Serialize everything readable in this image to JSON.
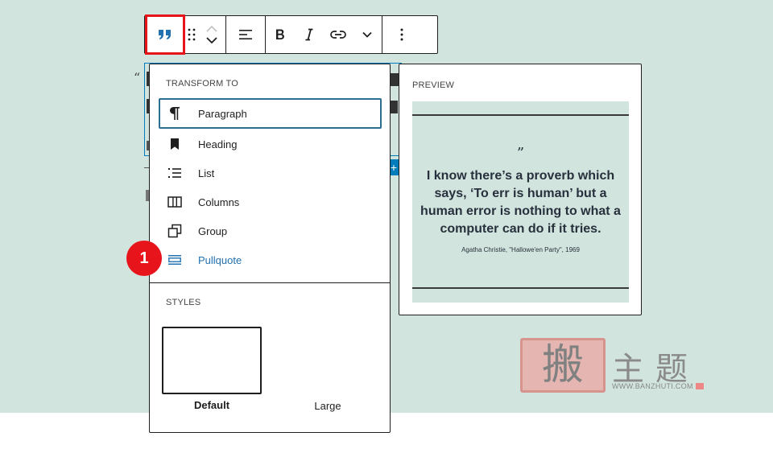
{
  "toolbar": {
    "quote_icon": "quote-icon",
    "drag_icon": "drag-handle-icon",
    "move_up_icon": "chevron-up-icon",
    "move_down_icon": "chevron-down-icon",
    "align_icon": "align-icon",
    "bold_icon": "bold-icon",
    "italic_icon": "italic-icon",
    "link_icon": "link-icon",
    "more_formats_icon": "chevron-down-icon",
    "options_icon": "more-vertical-icon"
  },
  "transform": {
    "title": "TRANSFORM TO",
    "items": [
      {
        "label": "Paragraph",
        "icon": "paragraph-icon"
      },
      {
        "label": "Heading",
        "icon": "bookmark-icon"
      },
      {
        "label": "List",
        "icon": "list-icon"
      },
      {
        "label": "Columns",
        "icon": "columns-icon"
      },
      {
        "label": "Group",
        "icon": "group-icon"
      },
      {
        "label": "Pullquote",
        "icon": "pullquote-icon"
      }
    ]
  },
  "styles": {
    "title": "STYLES",
    "options": [
      {
        "label": "Default"
      },
      {
        "label": "Large"
      }
    ]
  },
  "preview": {
    "title": "PREVIEW",
    "quote_mark": "”",
    "quote": "I know there’s a proverb which says, ‘To err is human’ but a human error is nothing to what a computer can do if it tries.",
    "citation": "Agatha Christie, \"Hallowe'en Party\", 1969"
  },
  "annotation": {
    "step": "1"
  },
  "watermark": {
    "stamp": "搬",
    "text": "主题",
    "url": "WWW.BANZHUTI.COM"
  },
  "colors": {
    "canvas": "#d1e4dd",
    "highlight": "#e8141c",
    "accent": "#2271b1",
    "focus": "#2c6e90"
  }
}
